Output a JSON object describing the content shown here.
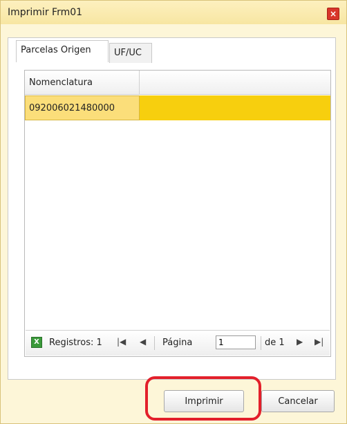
{
  "dialog": {
    "title": "Imprimir Frm01",
    "close_glyph": "×"
  },
  "tabs": [
    {
      "label": "Parcelas Origen",
      "active": true
    },
    {
      "label": "UF/UC",
      "active": false
    }
  ],
  "grid": {
    "columns": [
      "Nomenclatura"
    ],
    "rows": [
      {
        "nomenclatura": "092006021480000",
        "selected": true
      }
    ],
    "selected_row_color": "#f7cf0e"
  },
  "pager": {
    "export_icon": "excel-icon",
    "records_label": "Registros: 1",
    "first_glyph": "|◀",
    "prev_glyph": "◀",
    "page_label": "Página",
    "page_value": "1",
    "of_label": "de 1",
    "next_glyph": "▶",
    "last_glyph": "▶|"
  },
  "buttons": {
    "print_label": "Imprimir",
    "cancel_label": "Cancelar"
  },
  "annotation": {
    "highlight_color": "#e3202b"
  }
}
